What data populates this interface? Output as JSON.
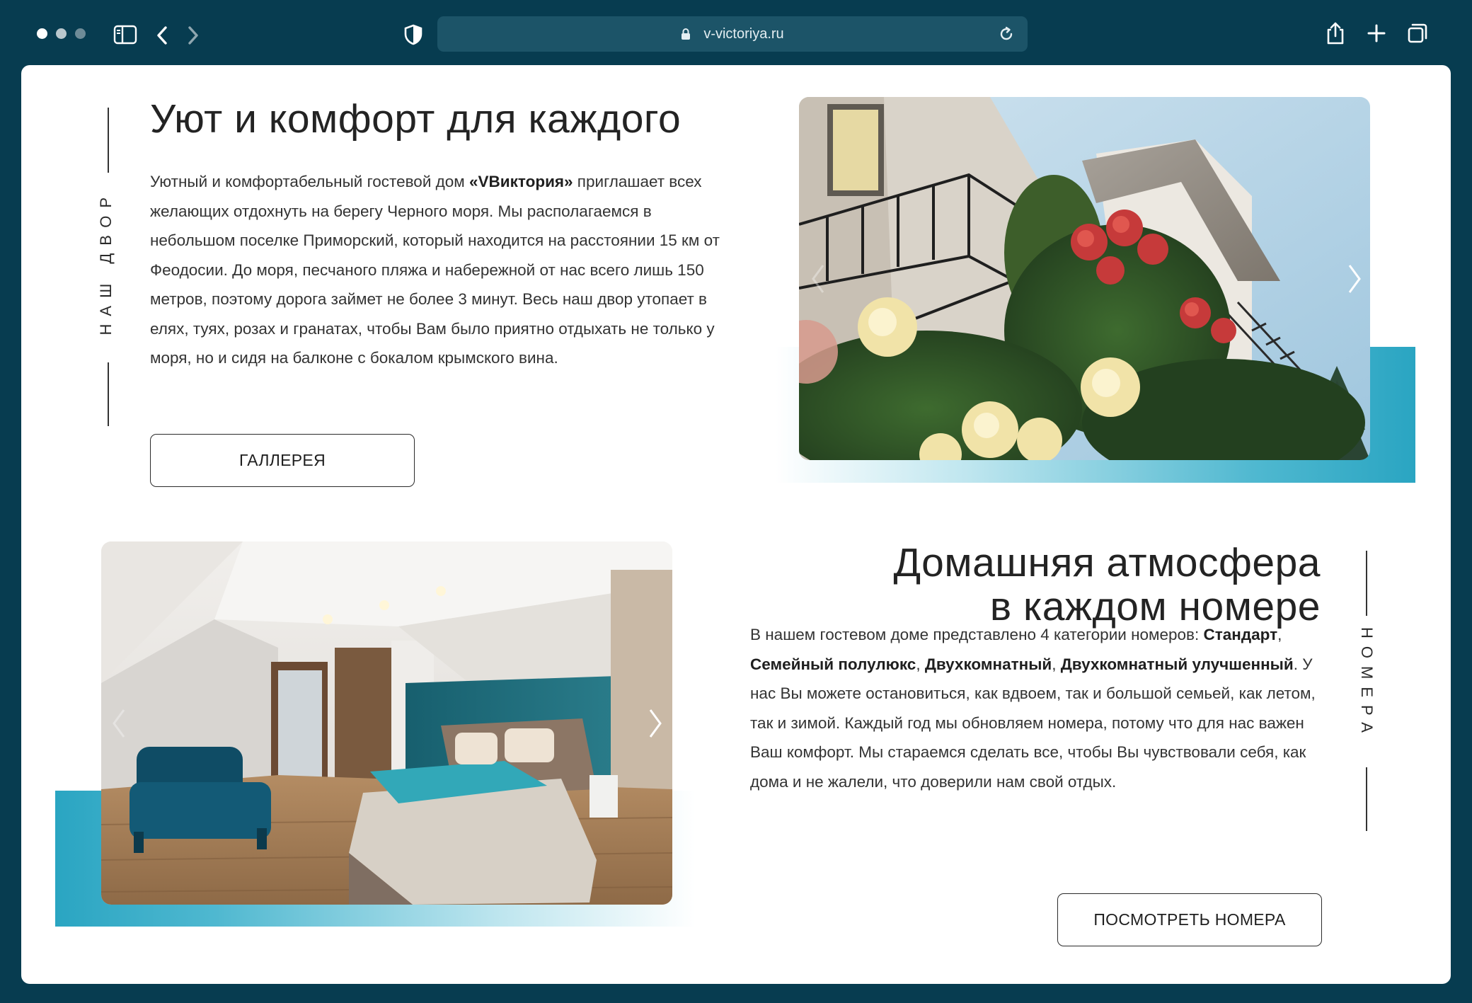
{
  "browser": {
    "url": "v-victoriya.ru",
    "traffic_colors": [
      "#ffffff",
      "#b9c7cd",
      "#6e8b97"
    ],
    "chrome_color": "#073c50",
    "addressbar_color": "#1c5468"
  },
  "icons": {
    "sidebar": "sidebar-icon",
    "back": "chevron-left-icon",
    "forward": "chevron-right-icon",
    "shield": "shield-icon",
    "lock": "lock-icon",
    "reload": "reload-icon",
    "share": "share-icon",
    "new_tab": "plus-icon",
    "tabs": "tabs-icon"
  },
  "section1": {
    "vertical_label": "НАШ ДВОР",
    "title": "Уют и комфорт для каждого",
    "paragraph": {
      "before": "Уютный и комфортабельный гостевой дом ",
      "bold": "«VВиктория»",
      "after": " приглашает всех желающих отдохнуть на берегу Черного моря. Мы располагаемся в небольшом поселке Приморский, который находится на расстоянии 15 км от Феодосии. До моря, песчаного пляжа и набережной от нас всего лишь 150 метров, поэтому дорога займет не более 3 минут. Весь наш двор утопает в елях, туях, розах и гранатах, чтобы Вам было приятно отдыхать не только у моря, но и сидя на балконе с бокалом крымского вина."
    },
    "button": "ГАЛЛЕРЕЯ",
    "accent_color": "#2fa9c4"
  },
  "section2": {
    "vertical_label": "НОМЕРА",
    "title_line1": "Домашняя атмосфера",
    "title_line2": "в каждом номере",
    "paragraph": {
      "intro": "В нашем гостевом доме представлено 4 категории номеров: ",
      "cat1": "Стандарт",
      "sep1": ", ",
      "cat2": "Семейный полулюкс",
      "sep2": ", ",
      "cat3": "Двухкомнатный",
      "sep3": ", ",
      "cat4": "Двухкомнатный улучшенный",
      "after": ". У нас Вы можете остановиться, как вдвоем, так и большой семьей, как летом, так и зимой. Каждый год мы обновляем номера, потому что для нас важен Ваш комфорт. Мы стараемся сделать все, чтобы Вы чувствовали себя, как дома и не жалели, что доверили нам свой отдых."
    },
    "button": "ПОСМОТРЕТЬ НОМЕРА",
    "accent_color": "#2fa9c4"
  }
}
